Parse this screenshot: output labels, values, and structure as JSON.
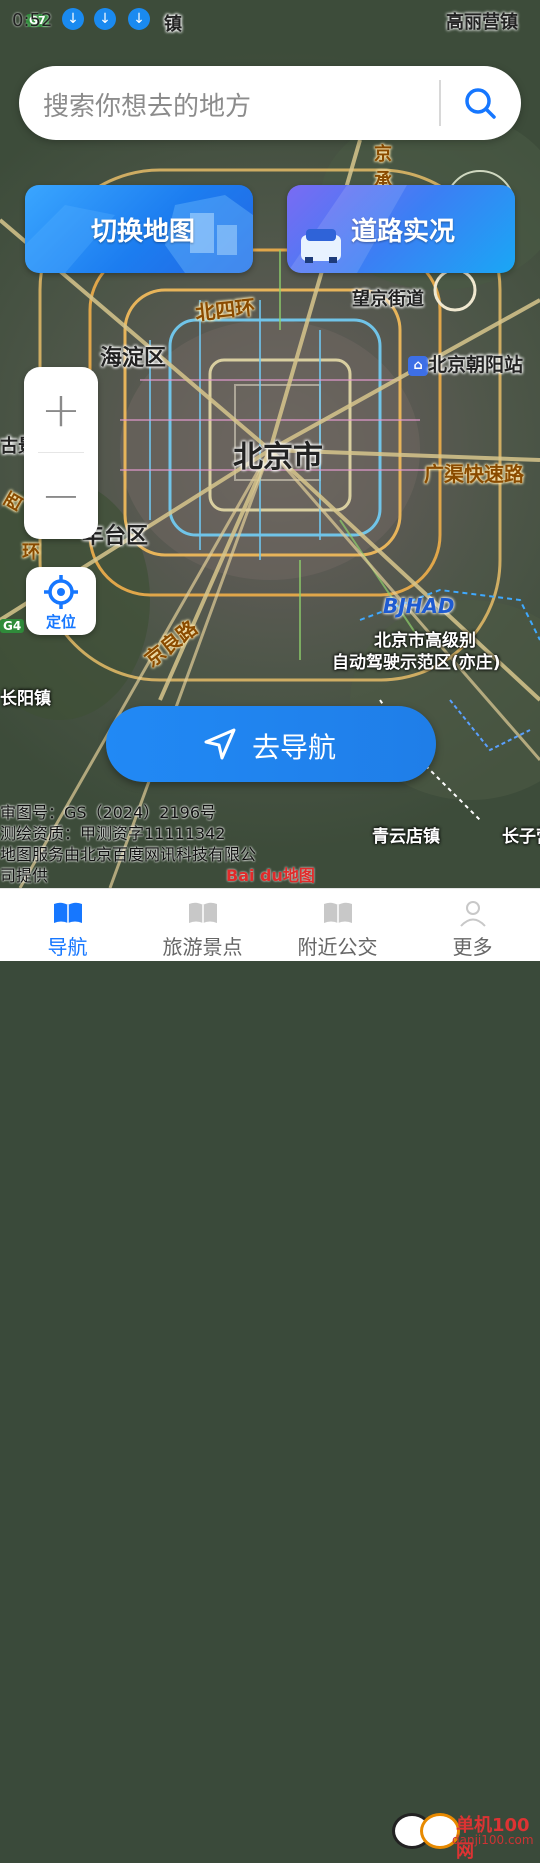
{
  "status_bar": {
    "time": "0:52",
    "right_text": "高丽营镇"
  },
  "search": {
    "placeholder": "搜索你想去的地方"
  },
  "cards": {
    "switch_map": "切换地图",
    "road_traffic": "道路实况"
  },
  "map_labels": {
    "city": "北京市",
    "haidian": "海淀区",
    "fengtai": "丰台区",
    "north_fourth_ring": "北四环",
    "wangjing": "望京街道",
    "chaoyang_station": "北京朝阳站",
    "guangqu": "广渠快速路",
    "jingliang": "京良路",
    "bjhad": "BJHAD",
    "bjhad_line1": "北京市高级别",
    "bjhad_line2": "自动驾驶示范区(亦庄)",
    "qingyundian": "青云店镇",
    "changziying": "长子营",
    "changyang": "长阳镇",
    "top_town": "镇",
    "left_chengshi": "承",
    "left_jing": "京",
    "left_jing2": "京",
    "left_gu": "古景",
    "left_xi": "西",
    "left_huan": "环",
    "badge_g7": "G7",
    "badge_g4": "G4"
  },
  "zoom": {
    "plus": "+",
    "minus": "−"
  },
  "locate": {
    "label": "定位"
  },
  "navigate": {
    "label": "去导航"
  },
  "copyright": {
    "line1": "审图号：GS（2024）2196号",
    "line2": "测绘资质：甲测资字11111342",
    "line3": "地图服务由北京百度网讯科技有限公",
    "line4": "司提供",
    "baidu_logo": "Bai du地图"
  },
  "tabs": [
    {
      "label": "导航",
      "active": true
    },
    {
      "label": "旅游景点",
      "active": false
    },
    {
      "label": "附近公交",
      "active": false
    },
    {
      "label": "更多",
      "active": false
    }
  ],
  "watermark": {
    "text": "单机100网",
    "url": "danji100.com"
  },
  "colors": {
    "accent": "#1677ff",
    "nav_button": "#2189f5"
  }
}
